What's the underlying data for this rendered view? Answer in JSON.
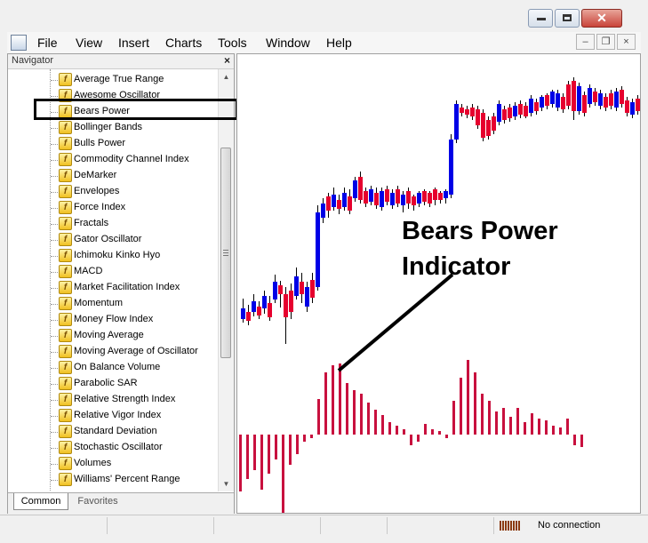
{
  "menubar": {
    "items": [
      "File",
      "View",
      "Insert",
      "Charts",
      "Tools",
      "Window",
      "Help"
    ]
  },
  "navigator": {
    "title": "Navigator",
    "close_glyph": "×",
    "items": [
      "Average True Range",
      "Awesome Oscillator",
      "Bears Power",
      "Bollinger Bands",
      "Bulls Power",
      "Commodity Channel Index",
      "DeMarker",
      "Envelopes",
      "Force Index",
      "Fractals",
      "Gator Oscillator",
      "Ichimoku Kinko Hyo",
      "MACD",
      "Market Facilitation Index",
      "Momentum",
      "Money Flow Index",
      "Moving Average",
      "Moving Average of Oscillator",
      "On Balance Volume",
      "Parabolic SAR",
      "Relative Strength Index",
      "Relative Vigor Index",
      "Standard Deviation",
      "Stochastic Oscillator",
      "Volumes",
      "Williams' Percent Range"
    ],
    "highlighted_item": "Bears Power",
    "item_icon": "function-f-icon",
    "tabs": [
      "Common",
      "Favorites"
    ],
    "active_tab": "Common"
  },
  "chart": {
    "annotation_line1": "Bears Power",
    "annotation_line2": "Indicator",
    "bull_color": "#0000e6",
    "bear_color": "#e6002e",
    "histogram_color": "#c8103e"
  },
  "status": {
    "connection": "No connection"
  },
  "colors": {
    "window_bg": "#f0f0f0",
    "highlight_border": "#000000",
    "close_button": "#c9443a"
  }
}
